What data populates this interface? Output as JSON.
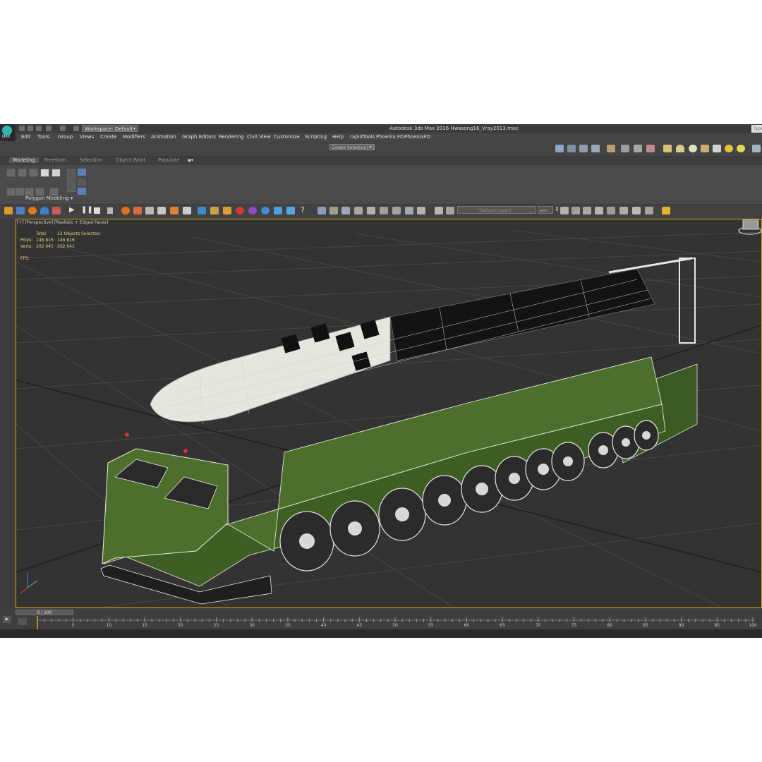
{
  "app": {
    "logo_label": "MAX",
    "title": "Autodesk 3ds Max 2016    Hwasong16_Vray2013.max",
    "workspace_label": "Workspace: Default",
    "search_placeholder": "Type"
  },
  "menu": {
    "items": [
      "Edit",
      "Tools",
      "Group",
      "Views",
      "Create",
      "Modifiers",
      "Animation",
      "Graph Editors",
      "Rendering",
      "Civil View",
      "Customize",
      "Scripting",
      "Help",
      "rapidTools",
      "Phoenix FD",
      "PhoenixFD"
    ]
  },
  "toolbar": {
    "selection_set_placeholder": "Create Selection Se",
    "layer_placeholder": "(Default Layer)"
  },
  "ribbon": {
    "tabs": [
      "Modeling",
      "Freeform",
      "Selection",
      "Object Paint",
      "Populate"
    ],
    "active_tab": "Modeling",
    "panel_label": "Polygon Modeling"
  },
  "viewport": {
    "label": "[+] [Perspective] [Realistic + Edged Faces]",
    "stats": {
      "total_header": "Total",
      "selected_header": "23 Objects Selected",
      "polys_label": "Polys:",
      "polys_total": "146 816",
      "polys_selected": "146 816",
      "verts_label": "Verts:",
      "verts_total": "202 041",
      "verts_selected": "202 041",
      "fps_label": "FPS:"
    }
  },
  "timeline": {
    "frame_display": "0 / 100",
    "ticks": [
      "5",
      "10",
      "15",
      "20",
      "25",
      "30",
      "35",
      "40",
      "45",
      "50",
      "55",
      "60",
      "65",
      "70",
      "75",
      "80",
      "85",
      "90",
      "95",
      "100"
    ]
  },
  "colors": {
    "accent": "#e0a10c",
    "viewport_bg": "#333333",
    "truck_green": "#4a6b2a",
    "stats_yellow": "#e8d47a"
  }
}
